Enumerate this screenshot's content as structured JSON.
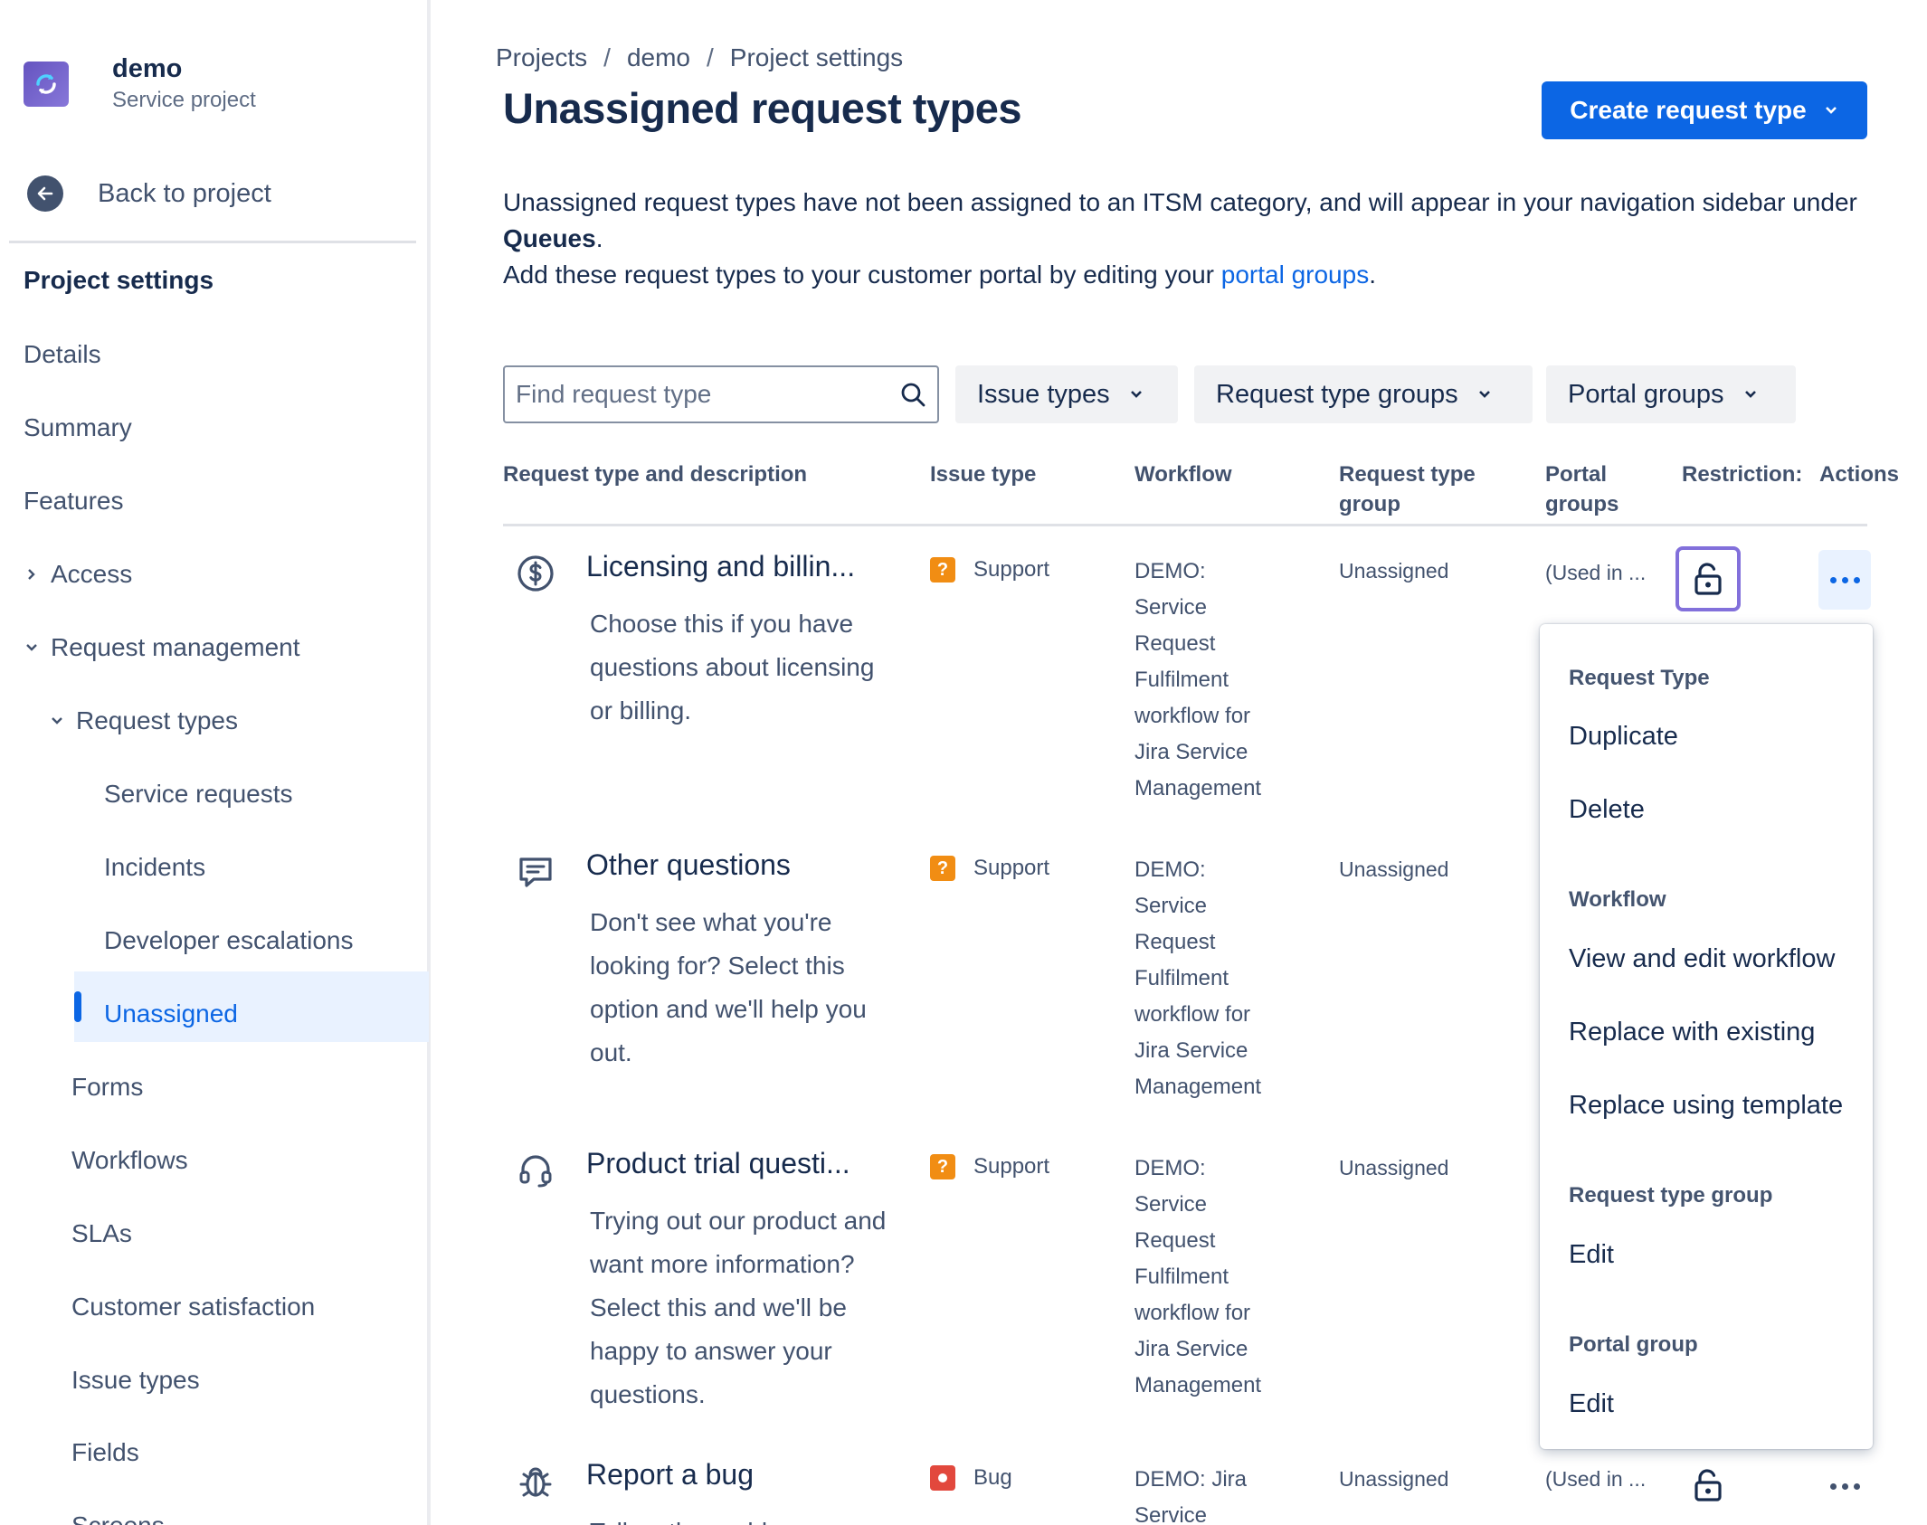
{
  "project": {
    "name": "demo",
    "type": "Service project"
  },
  "sidebar": {
    "back_label": "Back to project",
    "heading": "Project settings",
    "items": {
      "details": "Details",
      "summary": "Summary",
      "features": "Features",
      "access": "Access",
      "request_management": "Request management",
      "request_types": "Request types",
      "service_requests": "Service requests",
      "incidents": "Incidents",
      "developer_escalations": "Developer escalations",
      "unassigned": "Unassigned",
      "forms": "Forms",
      "workflows": "Workflows",
      "slas": "SLAs",
      "customer_satisfaction": "Customer satisfaction",
      "issue_types": "Issue types",
      "fields": "Fields",
      "screens": "Screens"
    }
  },
  "breadcrumb": {
    "projects": "Projects",
    "sep": "/",
    "demo": "demo",
    "settings": "Project settings"
  },
  "page": {
    "title": "Unassigned request types",
    "create_button": "Create request type",
    "desc_line1_a": "Unassigned request types have not been assigned to an ITSM category, and will appear in your navigation sidebar under ",
    "desc_line1_bold": "Queues",
    "desc_line1_end": ".",
    "desc_line2_a": "Add these request types to your customer portal by editing your ",
    "desc_line2_link": "portal groups",
    "desc_line2_end": "."
  },
  "filters": {
    "search_placeholder": "Find request type",
    "issue_types": "Issue types",
    "request_type_groups": "Request type groups",
    "portal_groups": "Portal groups"
  },
  "table": {
    "headers": {
      "name": "Request type and description",
      "issue_type": "Issue type",
      "workflow": "Workflow",
      "group_line1": "Request type",
      "group_line2": "group",
      "portal_line1": "Portal",
      "portal_line2": "groups",
      "restrictions": "Restriction:",
      "actions": "Actions"
    },
    "rows": [
      {
        "icon": "dollar-icon",
        "name": "Licensing and billin...",
        "desc": "Choose this if you have questions about licensing or billing.",
        "issue_type": "Support",
        "workflow": "DEMO: Service Request Fulfilment workflow for Jira Service Management",
        "group": "Unassigned",
        "portal": "(Used in ..."
      },
      {
        "icon": "message-icon",
        "name": "Other questions",
        "desc": "Don't see what you're looking for? Select this option and we'll help you out.",
        "issue_type": "Support",
        "workflow": "DEMO: Service Request Fulfilment workflow for Jira Service Management",
        "group": "Unassigned",
        "portal": ""
      },
      {
        "icon": "headset-icon",
        "name": "Product trial questi...",
        "desc": "Trying out our product and want more information? Select this and we'll be happy to answer your questions.",
        "issue_type": "Support",
        "workflow": "DEMO: Service Request Fulfilment workflow for Jira Service Management",
        "group": "Unassigned",
        "portal": ""
      },
      {
        "icon": "bug-icon",
        "name": "Report a bug",
        "desc": "Tell us the problems",
        "issue_type": "Bug",
        "workflow": "DEMO: Jira Service",
        "group": "Unassigned",
        "portal": "(Used in ..."
      }
    ]
  },
  "menu": {
    "section_request_type": "Request Type",
    "duplicate": "Duplicate",
    "delete": "Delete",
    "section_workflow": "Workflow",
    "view_edit_workflow": "View and edit workflow",
    "replace_existing": "Replace with existing",
    "replace_template": "Replace using template",
    "section_request_type_group": "Request type group",
    "edit_group": "Edit",
    "section_portal_group": "Portal group",
    "edit_portal": "Edit"
  },
  "colors": {
    "primary": "#0c66e4",
    "support_badge": "#f18d13",
    "bug_badge": "#e2483d",
    "focus_ring": "#8270db"
  }
}
